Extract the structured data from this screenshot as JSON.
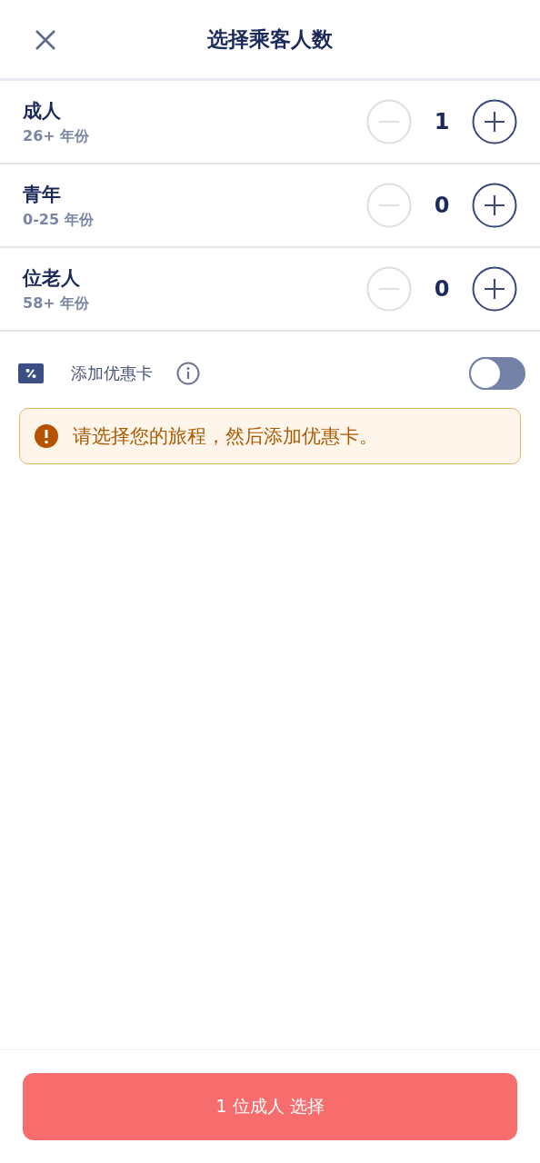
{
  "header": {
    "title": "选择乘客人数"
  },
  "passengers": [
    {
      "label": "成人",
      "age": "26+ 年份",
      "count": "1",
      "decrement_disabled": true,
      "increment_disabled": false
    },
    {
      "label": "青年",
      "age": "0-25 年份",
      "count": "0",
      "decrement_disabled": true,
      "increment_disabled": false
    },
    {
      "label": "位老人",
      "age": "58+ 年份",
      "count": "0",
      "decrement_disabled": true,
      "increment_disabled": false
    }
  ],
  "discount_card": {
    "label": "添加优惠卡",
    "on": false
  },
  "alert": {
    "text": "请选择您的旅程，然后添加优惠卡。"
  },
  "footer": {
    "button": "1 位成人 选择"
  }
}
